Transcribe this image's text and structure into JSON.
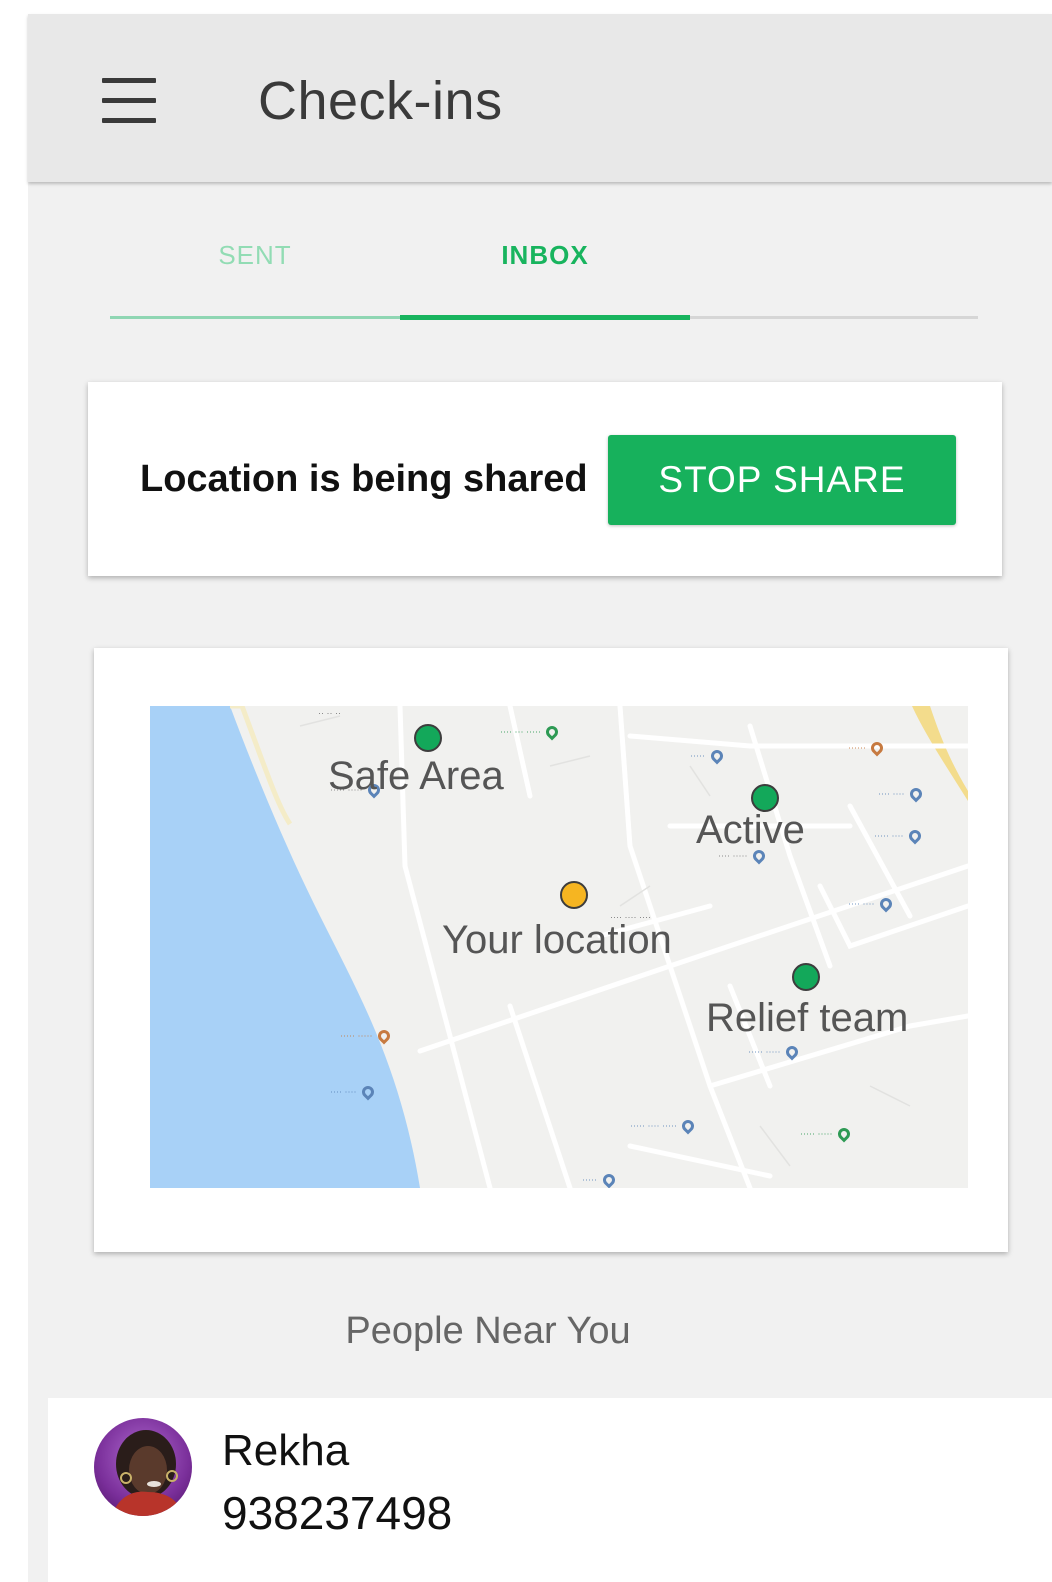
{
  "header": {
    "title": "Check-ins"
  },
  "tabs": [
    {
      "label": "SENT",
      "active": false
    },
    {
      "label": "INBOX",
      "active": true
    }
  ],
  "share_card": {
    "status_text": "Location is being shared",
    "button_label": "STOP SHARE"
  },
  "map": {
    "markers": [
      {
        "label": "Safe Area",
        "color": "green"
      },
      {
        "label": "Active",
        "color": "green"
      },
      {
        "label": "Your location",
        "color": "orange"
      },
      {
        "label": "Relief team",
        "color": "green"
      }
    ],
    "colors": {
      "water": "#a8d1f7",
      "land": "#f1f1ef",
      "road": "#ffffff",
      "marker_green": "#13a85a",
      "marker_orange": "#f6b521"
    }
  },
  "people_section": {
    "title": "People Near You",
    "people": [
      {
        "name": "Rekha",
        "phone": "938237498"
      }
    ]
  },
  "colors": {
    "accent": "#18b45e",
    "button": "#17b15c",
    "topbar": "#e8e8e8"
  }
}
